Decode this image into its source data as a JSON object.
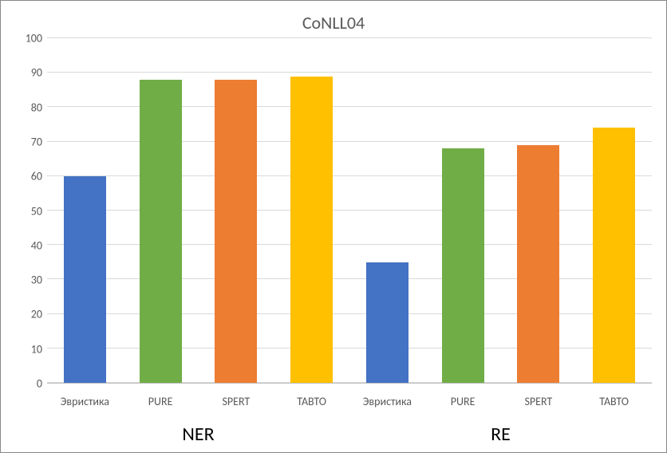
{
  "chart_data": {
    "type": "bar",
    "title": "CoNLL04",
    "ylabel": "",
    "xlabel": "",
    "ylim": [
      0,
      100
    ],
    "y_ticks": [
      0,
      10,
      20,
      30,
      40,
      50,
      60,
      70,
      80,
      90,
      100
    ],
    "groups": [
      "NER",
      "RE"
    ],
    "bar_labels": [
      "Эвристика",
      "PURE",
      "SPERT",
      "TABTO"
    ],
    "series": [
      {
        "name": "Эвристика",
        "color": "#4472C4",
        "values": [
          60,
          35
        ]
      },
      {
        "name": "PURE",
        "color": "#70AD47",
        "values": [
          88,
          68
        ]
      },
      {
        "name": "SPERT",
        "color": "#ED7D31",
        "values": [
          88,
          69
        ]
      },
      {
        "name": "TABTO",
        "color": "#FFC000",
        "values": [
          89,
          74
        ]
      }
    ]
  }
}
